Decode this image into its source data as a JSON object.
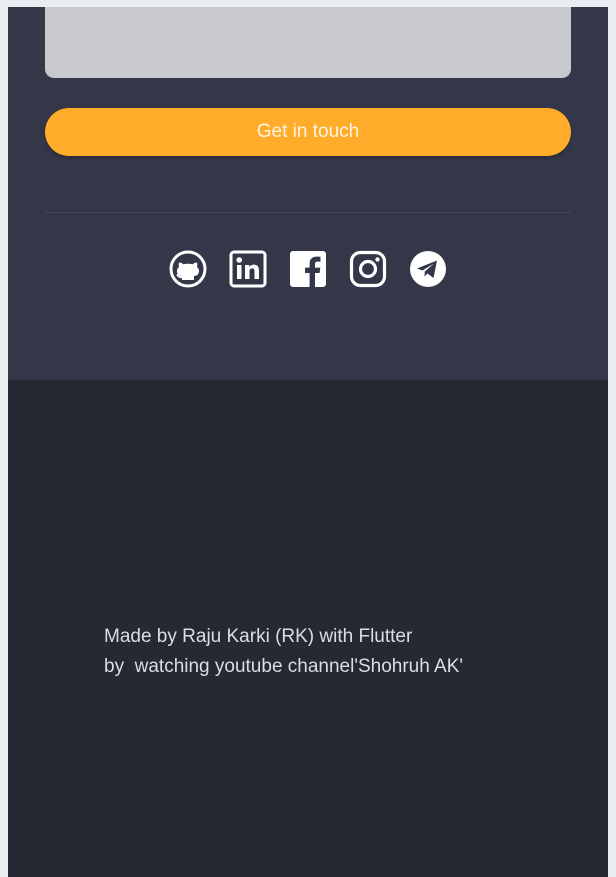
{
  "contact": {
    "message_value": "",
    "cta_label": "Get in touch"
  },
  "social": {
    "items": [
      {
        "name": "github",
        "icon": "github-icon"
      },
      {
        "name": "linkedin",
        "icon": "linkedin-icon"
      },
      {
        "name": "facebook",
        "icon": "facebook-icon"
      },
      {
        "name": "instagram",
        "icon": "instagram-icon"
      },
      {
        "name": "telegram",
        "icon": "telegram-icon"
      }
    ]
  },
  "footer": {
    "credit_line1": "Made by Raju Karki (RK) with Flutter",
    "credit_line2": "by  watching youtube channel'Shohruh AK'"
  },
  "colors": {
    "accent": "#ffac2b",
    "section_bg": "#343748",
    "footer_bg": "#262834",
    "icon": "#ffffff"
  }
}
